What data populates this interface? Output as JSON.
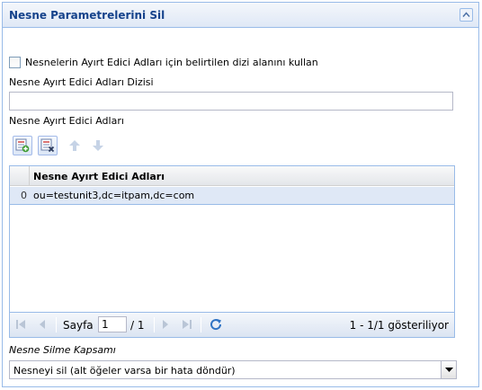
{
  "panel": {
    "title": "Nesne Parametrelerini Sil"
  },
  "form": {
    "use_array_checkbox_label": "Nesnelerin Ayırt Edici Adları için belirtilen dizi alanını kullan",
    "array_field_label": "Nesne Ayırt Edici Adları Dizisi",
    "array_field_value": "",
    "names_label": "Nesne Ayırt Edici Adları"
  },
  "toolbar": {
    "icons": [
      "add-row-icon",
      "delete-row-icon",
      "move-up-icon",
      "move-down-icon"
    ]
  },
  "grid": {
    "column_header": "Nesne Ayırt Edici Adları",
    "rows": [
      {
        "index": "0",
        "value": "ou=testunit3,dc=itpam,dc=com"
      }
    ]
  },
  "pager": {
    "page_label": "Sayfa",
    "current_page": "1",
    "of_label": "/ 1",
    "info": "1 - 1/1 gösteriliyor"
  },
  "scope": {
    "label": "Nesne Silme Kapsamı",
    "selected": "Nesneyi sil (alt öğeler varsa bir hata döndür)"
  }
}
